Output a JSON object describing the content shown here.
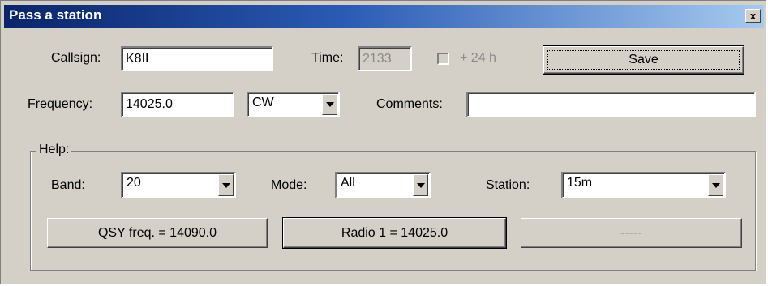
{
  "window": {
    "title": "Pass a station",
    "close_glyph": "x"
  },
  "callsign": {
    "label": "Callsign:",
    "value": "K8II"
  },
  "time": {
    "label": "Time:",
    "value": "2133"
  },
  "plus24": {
    "label": "+ 24 h",
    "checked": false
  },
  "save_button": {
    "label": "Save"
  },
  "frequency": {
    "label": "Frequency:",
    "value": "14025.0"
  },
  "mode_select": {
    "value": "CW"
  },
  "comments": {
    "label": "Comments:",
    "value": ""
  },
  "help": {
    "legend": "Help:",
    "band": {
      "label": "Band:",
      "value": "20"
    },
    "mode": {
      "label": "Mode:",
      "value": "All"
    },
    "station": {
      "label": "Station:",
      "value": "15m"
    },
    "qsy_button": {
      "label": "QSY freq. = 14090.0"
    },
    "radio_button": {
      "label": "Radio 1 = 14025.0"
    },
    "blank_button": {
      "label": "-----"
    }
  },
  "icons": {
    "dropdown": "chevron-down-icon",
    "close": "close-icon"
  }
}
